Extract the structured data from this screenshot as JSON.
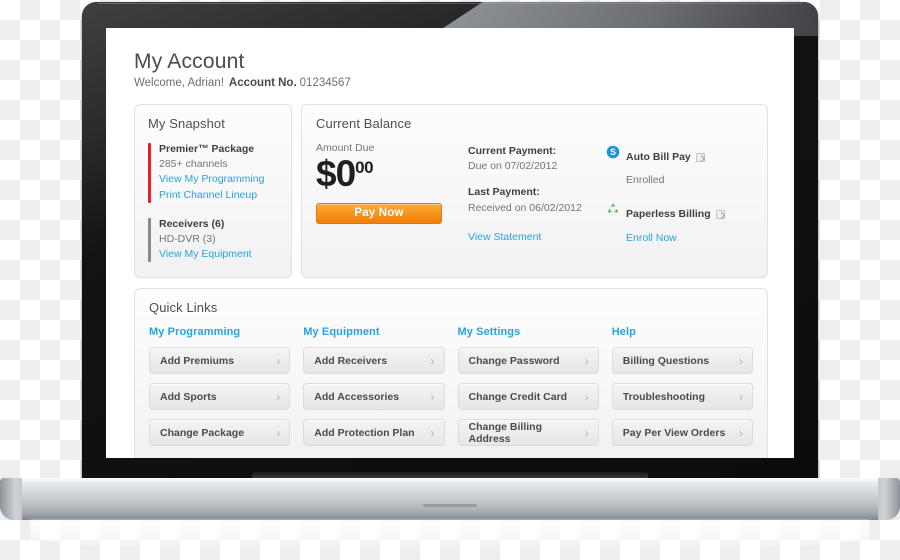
{
  "header": {
    "title": "My Account",
    "welcome": "Welcome, Adrian!",
    "account_label": "Account No.",
    "account_number": "01234567"
  },
  "snapshot": {
    "title": "My Snapshot",
    "blocks": [
      {
        "bar_color": "#e0202a",
        "title": "Premier™ Package",
        "sub": "285+ channels",
        "links": [
          "View My Programming",
          "Print Channel Lineup"
        ]
      },
      {
        "bar_color": "#8a8a8a",
        "title": "Receivers (6)",
        "sub": "HD-DVR (3)",
        "links": [
          "View My Equipment"
        ]
      }
    ]
  },
  "balance": {
    "title": "Current Balance",
    "amount_label": "Amount Due",
    "currency": "$",
    "dollars": "0",
    "cents": "00",
    "pay_button": "Pay Now",
    "current_payment": {
      "title": "Current Payment:",
      "sub": "Due on 07/02/2012"
    },
    "last_payment": {
      "title": "Last Payment:",
      "sub": "Received on 06/02/2012"
    },
    "view_statement": "View Statement",
    "services": [
      {
        "icon": "dollar-circle-icon",
        "icon_color": "#2196d6",
        "name": "Auto Bill Pay",
        "status_text": "Enrolled",
        "status_is_link": false
      },
      {
        "icon": "recycle-icon",
        "icon_color": "#3cb54a",
        "name": "Paperless Billing",
        "status_text": "Enroll Now",
        "status_is_link": true
      }
    ]
  },
  "quick_links": {
    "title": "Quick Links",
    "columns": [
      {
        "heading": "My Programming",
        "items": [
          "Add Premiums",
          "Add Sports",
          "Change Package"
        ]
      },
      {
        "heading": "My Equipment",
        "items": [
          "Add Receivers",
          "Add Accessories",
          "Add Protection Plan"
        ]
      },
      {
        "heading": "My Settings",
        "items": [
          "Change Password",
          "Change Credit Card",
          "Change Billing Address"
        ]
      },
      {
        "heading": "Help",
        "items": [
          "Billing Questions",
          "Troubleshooting",
          "Pay Per View Orders"
        ]
      }
    ],
    "chevron": "›"
  },
  "colors": {
    "link_blue": "#29a3dc",
    "accent_orange": "#f8951e",
    "premier_red": "#e0202a",
    "receiver_gray": "#8a8a8a"
  }
}
